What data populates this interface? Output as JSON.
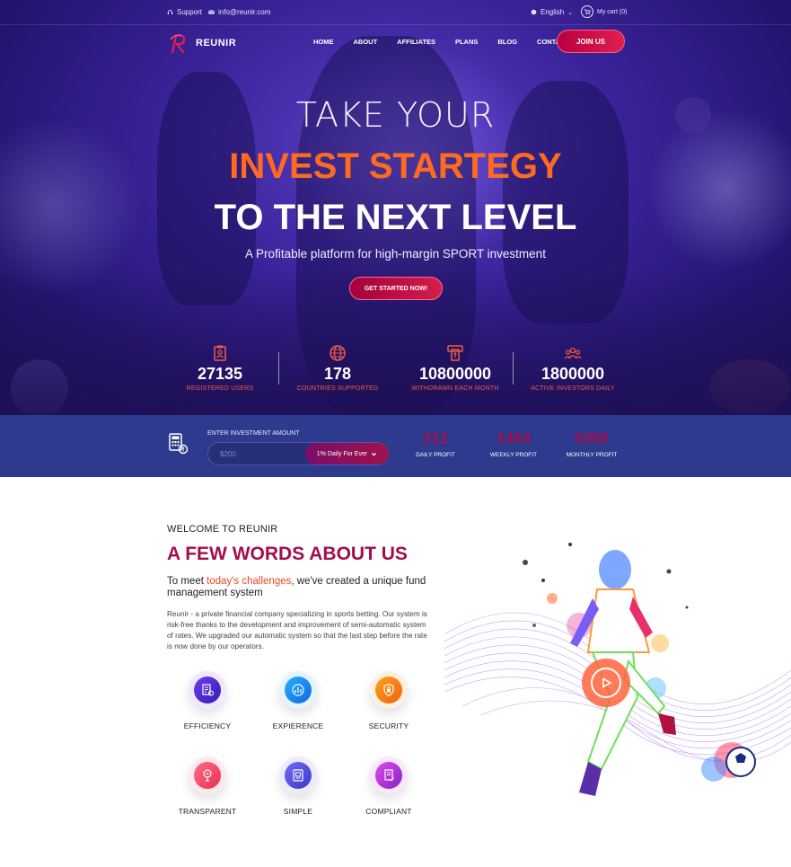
{
  "topbar": {
    "support_label": "Support",
    "email": "info@reunir.com",
    "language": "English",
    "cart_label": "My cart (0)"
  },
  "nav": {
    "brand": "REUNIR",
    "links": [
      "HOME",
      "ABOUT",
      "AFFILIATES",
      "PLANS",
      "BLOG",
      "CONTACT"
    ],
    "join_label": "JOIN US"
  },
  "hero": {
    "line1": "TAKE YOUR",
    "line2": "INVEST STARTEGY",
    "line3": "TO THE NEXT LEVEL",
    "subtitle": "A Profitable platform for high-margin SPORT investment",
    "cta_label": "GET STARTED NOW!"
  },
  "stats": [
    {
      "icon": "clipboard-user-icon",
      "value": "27135",
      "label": "REGISTERED USERS"
    },
    {
      "icon": "globe-icon",
      "value": "178",
      "label": "COUNTRIES SUPPORTED"
    },
    {
      "icon": "atm-withdraw-icon",
      "value": "10800000",
      "label": "WITHDRAWN EACH MONTH"
    },
    {
      "icon": "investors-group-icon",
      "value": "1800000",
      "label": "ACTIVE INVESTORS DAILY"
    }
  ],
  "calculator": {
    "label": "ENTER INVESTMENT AMOUNT",
    "placeholder": "$200",
    "plan_selected": "1% Daily For Ever",
    "profits": [
      {
        "value": "212",
        "label": "DAILY PROFIT"
      },
      {
        "value": "1484",
        "label": "WEEKLY PROFIT"
      },
      {
        "value": "6360",
        "label": "MONTHLY PROFIT"
      }
    ]
  },
  "about": {
    "welcome": "WELCOME TO REUNIR",
    "title": "A FEW WORDS ABOUT US",
    "lead_before": "To meet ",
    "lead_highlight": "today's challenges",
    "lead_after": ", we've created a unique fund management system",
    "body": "Reunir - a private financial company specializing in sports betting. Our system is risk-free thanks to the development and improvement of semi-automatic system of rates. We upgraded our automatic system so that the last step before the rate is now done by our operators.",
    "features": [
      {
        "label": "EFFICIENCY",
        "icon": "efficiency-icon"
      },
      {
        "label": "EXPIERENCE",
        "icon": "experience-icon"
      },
      {
        "label": "SECURITY",
        "icon": "security-icon"
      },
      {
        "label": "TRANSPARENT",
        "icon": "transparent-icon"
      },
      {
        "label": "SIMPLE",
        "icon": "simple-icon"
      },
      {
        "label": "COMPLIANT",
        "icon": "compliant-icon"
      }
    ]
  },
  "colors": {
    "hero_bg": "#3a239a",
    "accent_orange": "#ff6a1f",
    "accent_crimson": "#a30d4f",
    "button_red": "#d31f4a",
    "calc_band": "#2e3a8e"
  }
}
